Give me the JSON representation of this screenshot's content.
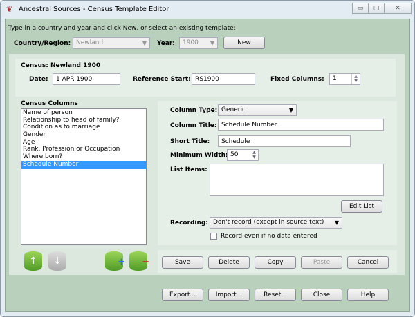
{
  "window": {
    "title": "Ancestral Sources - Census Template Editor",
    "controls": {
      "minimize": "▭",
      "maximize": "▢",
      "close": "✕"
    }
  },
  "instructions": "Type in a country and year and click New, or select an existing template:",
  "selector": {
    "country_label": "Country/Region:",
    "country_value": "Newland",
    "year_label": "Year:",
    "year_value": "1900",
    "new_label": "New"
  },
  "census": {
    "heading": "Census: Newland 1900",
    "date_label": "Date:",
    "date_value": "1 APR 1900",
    "ref_label": "Reference Start:",
    "ref_value": "RS1900",
    "fixed_label": "Fixed Columns:",
    "fixed_value": "1"
  },
  "columns": {
    "heading": "Census Columns",
    "items": [
      "Name of person",
      "Relationship to head of family?",
      "Condition as to marriage",
      "Gender",
      "Age",
      "Rank, Profession or Occupation",
      "Where born?",
      "Schedule Number"
    ],
    "selected_index": 7
  },
  "detail": {
    "type_label": "Column Type:",
    "type_value": "Generic",
    "title_label": "Column Title:",
    "title_value": "Schedule Number",
    "short_label": "Short Title:",
    "short_value": "Schedule",
    "minwidth_label": "Minimum Width:",
    "minwidth_value": "50",
    "list_label": "List Items:",
    "list_value": "",
    "edit_list": "Edit List",
    "recording_label": "Recording:",
    "recording_value": "Don't record (except in source text)",
    "record_empty_label": "Record even if no data entered",
    "record_empty_checked": false
  },
  "actions": {
    "save": "Save",
    "delete": "Delete",
    "copy": "Copy",
    "paste": "Paste",
    "cancel": "Cancel"
  },
  "footer": {
    "export": "Export...",
    "import": "Import...",
    "reset": "Reset...",
    "close": "Close",
    "help": "Help"
  }
}
